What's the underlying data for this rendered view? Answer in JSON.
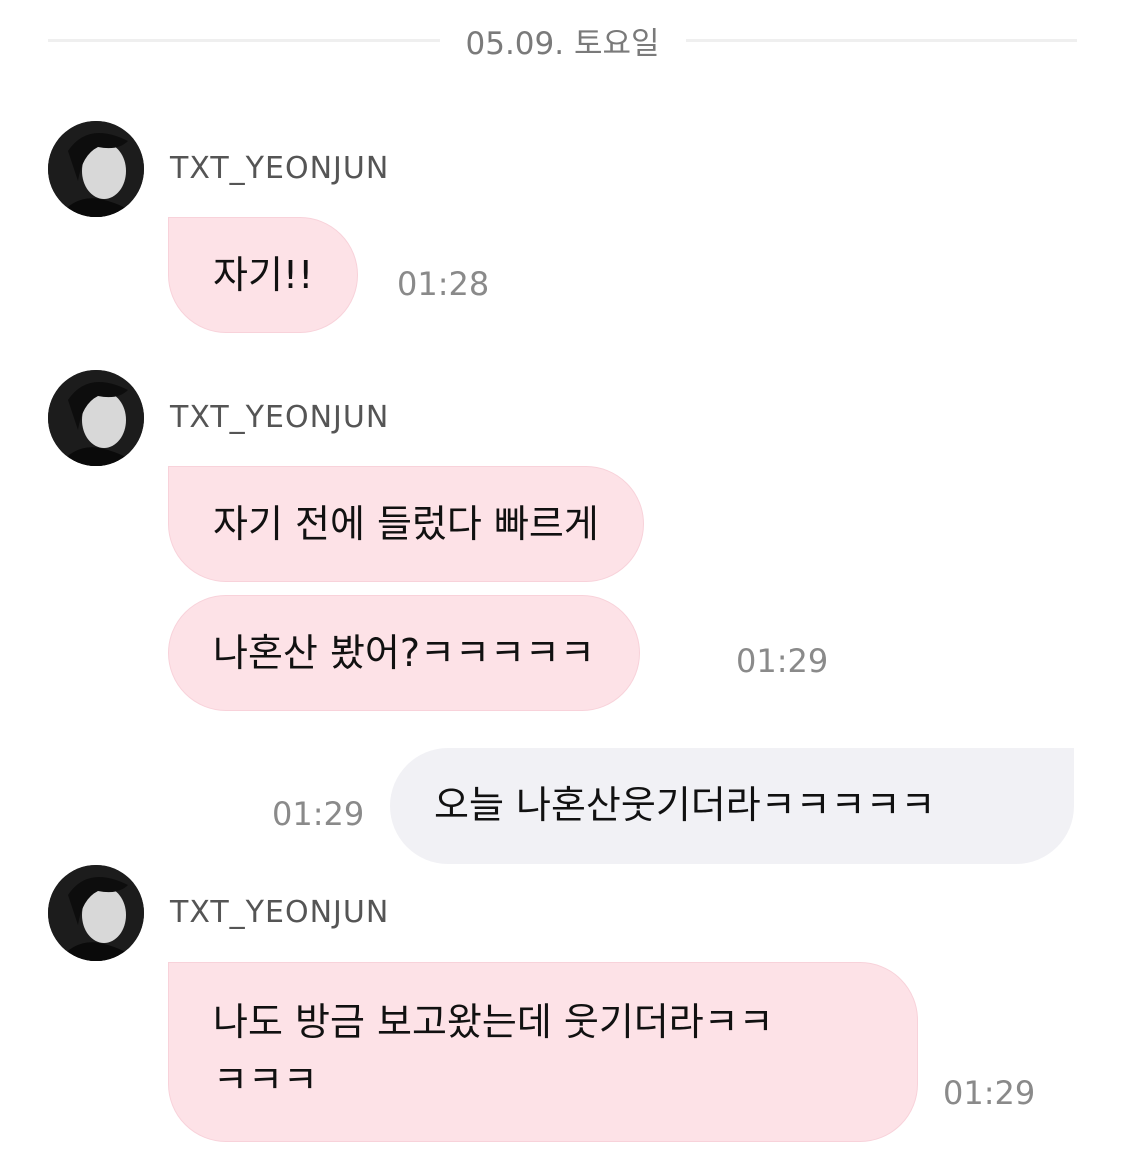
{
  "date_separator": "05.09. 토요일",
  "messages": [
    {
      "sender": "TXT_YEONJUN",
      "text": "자기!!",
      "time": "01:28"
    },
    {
      "sender": "TXT_YEONJUN",
      "text_line1": "자기 전에 들렀다 빠르게",
      "text_line2": "나혼산 봤어?ㅋㅋㅋㅋㅋ",
      "time": "01:29"
    },
    {
      "sender": "me",
      "text": "오늘 나혼산웃기더라ㅋㅋㅋㅋㅋ",
      "time": "01:29"
    },
    {
      "sender": "TXT_YEONJUN",
      "text_a": "나도 방금 보고왔는데 웃기더라ㅋㅋ",
      "text_b": "ㅋㅋㅋ",
      "time": "01:29"
    }
  ],
  "colors": {
    "incoming_bubble": "#fde2e7",
    "outgoing_bubble": "#f1f1f5",
    "time_text": "#8a8a8a"
  }
}
